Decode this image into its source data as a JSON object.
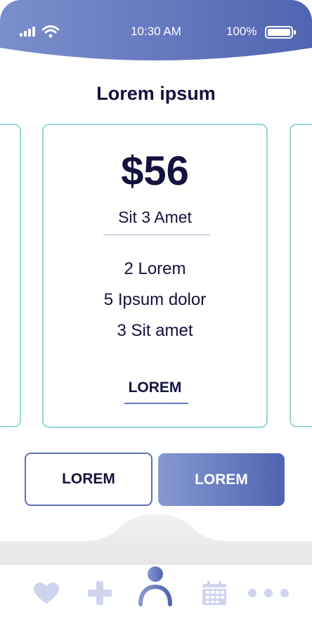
{
  "status_bar": {
    "time": "10:30 AM",
    "battery": "100%"
  },
  "page": {
    "title": "Lorem ipsum"
  },
  "card": {
    "price": "$56",
    "plan": "Sit 3 Amet",
    "features": [
      "2 Lorem",
      "5 Ipsum dolor",
      "3 Sit amet"
    ],
    "link": "LOREM"
  },
  "buttons": {
    "secondary": "LOREM",
    "primary": "LOREM"
  },
  "tab_bar": {
    "icons": [
      "heart-icon",
      "plus-icon",
      "profile-icon",
      "calendar-icon",
      "more-icon"
    ]
  },
  "colors": {
    "accent": "#5c70b6",
    "card_border": "#9ad7d6",
    "text": "#14123d",
    "tab_icon": "#cfd4ee"
  }
}
